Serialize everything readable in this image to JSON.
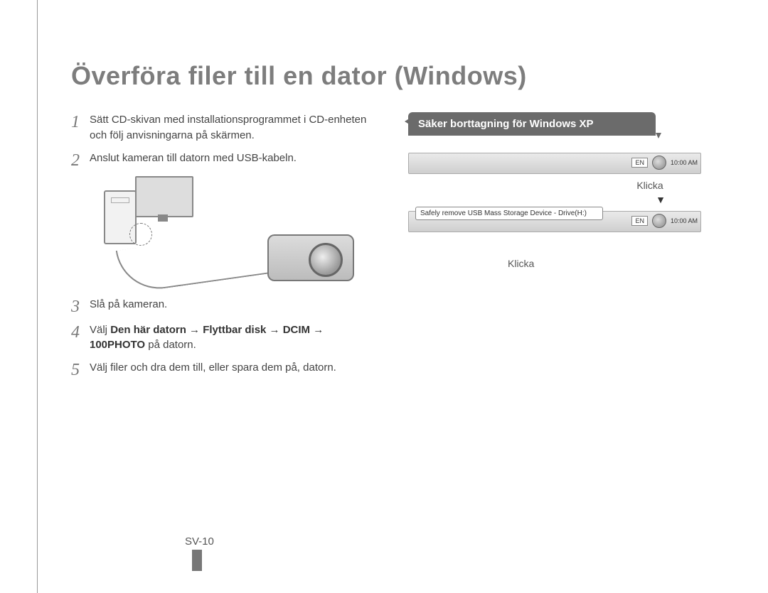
{
  "title": "Överföra filer till en dator (Windows)",
  "steps": [
    {
      "num": "1",
      "text": "Sätt CD-skivan med installationsprogrammet i CD-enheten och följ anvisningarna på skärmen."
    },
    {
      "num": "2",
      "text": "Anslut kameran till datorn med USB-kabeln."
    },
    {
      "num": "3",
      "text": "Slå på kameran."
    },
    {
      "num": "4",
      "prefix": "Välj ",
      "bold": "Den här datorn → Flyttbar disk → DCIM → 100PHOTO",
      "suffix": " på datorn."
    },
    {
      "num": "5",
      "text": "Välj filer och dra dem till, eller spara dem på, datorn."
    }
  ],
  "callout": {
    "header": "Säker borttagning för Windows XP",
    "click1": "Klicka",
    "arrow": "▼",
    "balloon_text": "Safely remove USB Mass Storage Device - Drive(H:)",
    "click2": "Klicka"
  },
  "tray": {
    "lang": "EN",
    "time": "10:00 AM"
  },
  "page_number": "SV-10"
}
